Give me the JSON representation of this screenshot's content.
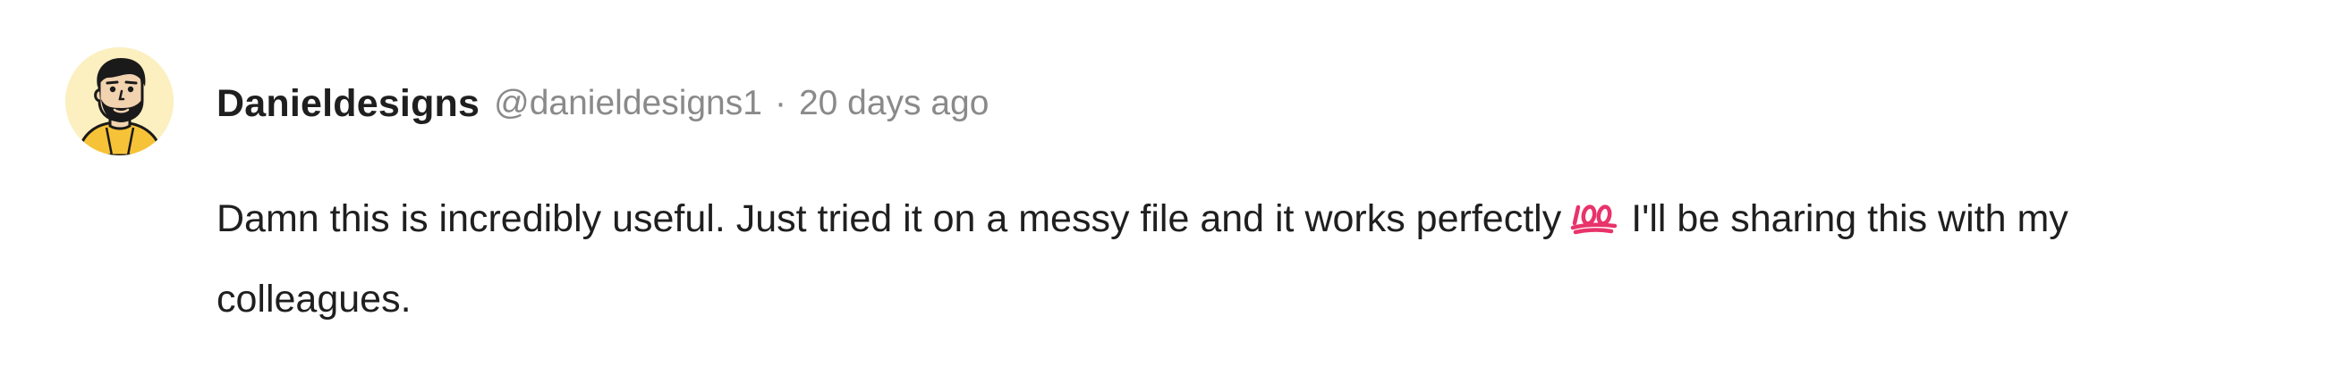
{
  "comment": {
    "author_name": "Danieldesigns",
    "author_handle": "@danieldesigns1",
    "separator": "·",
    "timestamp": "20 days ago",
    "body_before_emoji": "Damn this is incredibly useful. Just tried it on a messy file and it works perfectly",
    "emoji": "hundred-points-icon",
    "body_after_emoji": "I'll be sharing this with my colleagues."
  },
  "colors": {
    "author": "#1f1f1f",
    "meta": "#8a8a8a",
    "avatar_bg": "#fcefc0",
    "emoji": "#e8336b"
  }
}
